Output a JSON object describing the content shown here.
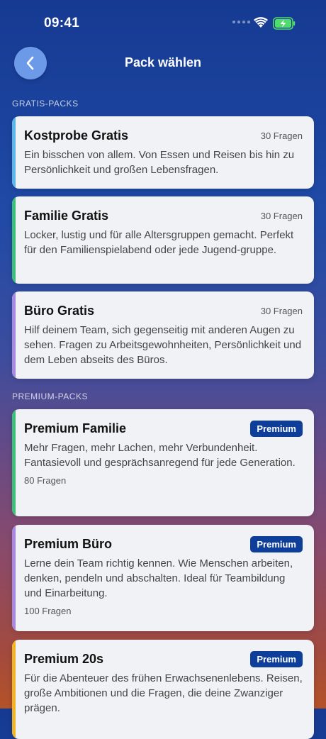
{
  "status": {
    "time": "09:41"
  },
  "nav": {
    "title": "Pack wählen",
    "back_icon": "chevron-left-icon"
  },
  "sections": {
    "free": "GRATIS-PACKS",
    "premium": "PREMIUM-PACKS"
  },
  "free_packs": [
    {
      "title": "Kostprobe Gratis",
      "count": "30 Fragen",
      "desc": "Ein bisschen von allem. Von Essen und Reisen bis hin zu Persönlichkeit und großen Lebensfragen.",
      "accent": "#5fb4e8"
    },
    {
      "title": "Familie Gratis",
      "count": "30 Fragen",
      "desc": "Locker, lustig und für alle Altersgruppen gemacht. Perfekt für den Familienspielabend oder jede Jugend-gruppe.",
      "accent": "#3dbf7a"
    },
    {
      "title": "Büro Gratis",
      "count": "30 Fragen",
      "desc": "Hilf deinem Team, sich gegenseitig mit anderen Augen zu sehen. Fragen zu Arbeitsgewohnheiten, Persönlichkeit und dem Leben abseits des Büros.",
      "accent": "#a78ae0"
    }
  ],
  "premium_packs": [
    {
      "title": "Premium Familie",
      "badge": "Premium",
      "desc": "Mehr Fragen, mehr Lachen, mehr Verbundenheit. Fantasievoll und gesprächsanregend für jede Generation.",
      "count": "80 Fragen",
      "accent": "#3dbf7a"
    },
    {
      "title": "Premium Büro",
      "badge": "Premium",
      "desc": "Lerne dein Team richtig kennen. Wie Menschen arbeiten, denken, pendeln und abschalten. Ideal für Teambildung und Einarbeitung.",
      "count": "100 Fragen",
      "accent": "#a78ae0"
    },
    {
      "title": "Premium 20s",
      "badge": "Premium",
      "desc": "Für die Abenteuer des frühen Erwachsenenlebens. Reisen, große Ambitionen und die Fragen, die deine Zwanziger prägen.",
      "accent": "#f0b429"
    }
  ]
}
